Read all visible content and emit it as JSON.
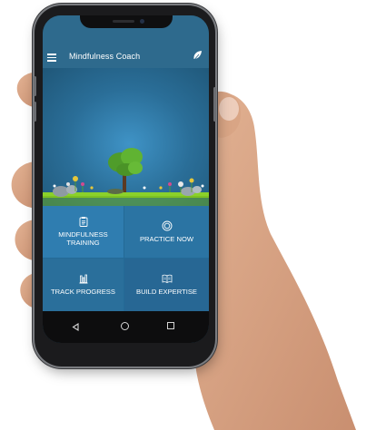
{
  "app": {
    "title": "Mindfulness Coach",
    "menu_icon": "menu-icon",
    "action_icon": "leaf-icon"
  },
  "tiles": [
    {
      "label_line1": "MINDFULNESS",
      "label_line2": "TRAINING",
      "icon": "clipboard-icon"
    },
    {
      "label_line1": "PRACTICE NOW",
      "label_line2": "",
      "icon": "target-icon"
    },
    {
      "label_line1": "TRACK PROGRESS",
      "label_line2": "",
      "icon": "bar-chart-icon"
    },
    {
      "label_line1": "BUILD EXPERTISE",
      "label_line2": "",
      "icon": "book-icon"
    }
  ],
  "navigation": {
    "back_icon": "back-triangle-icon",
    "home_icon": "home-circle-icon",
    "recent_icon": "recent-square-icon"
  },
  "colors": {
    "appbar": "#2e6a8d",
    "tile_primary": "#2f7db0",
    "grass": "#8bd12a",
    "tree": "#56a52b"
  }
}
